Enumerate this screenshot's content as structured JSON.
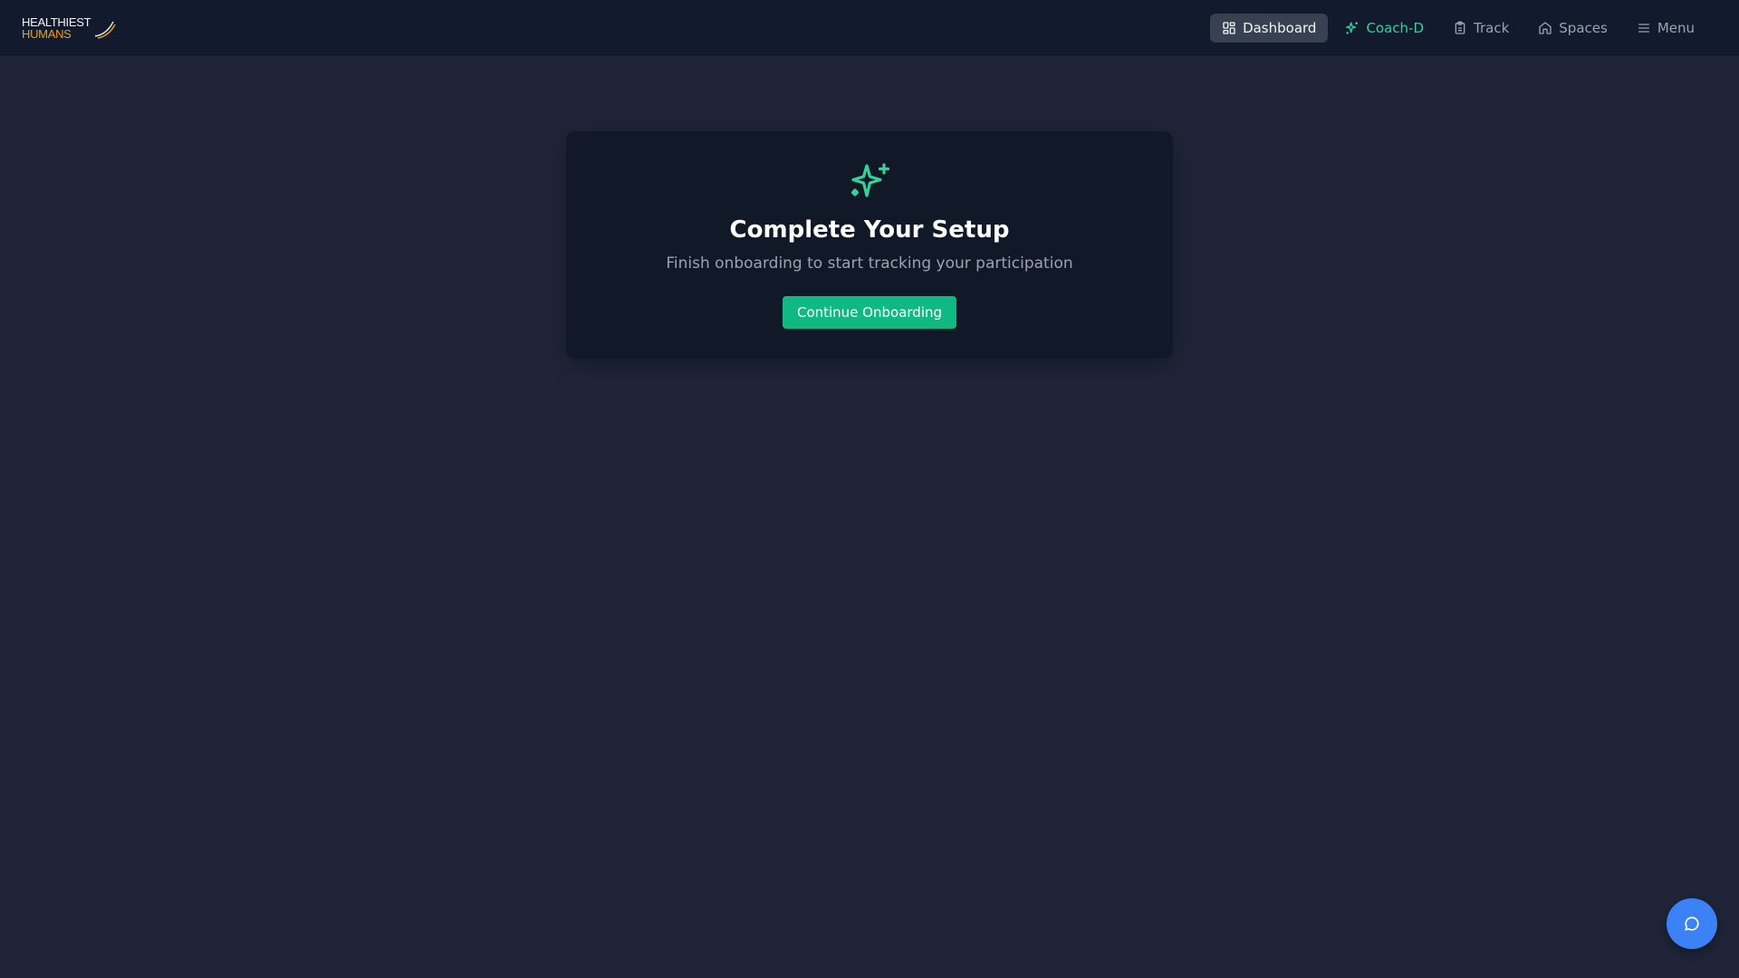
{
  "brand": {
    "line1": "HEALTHIEST",
    "line2": "HUMANS"
  },
  "nav": {
    "items": [
      {
        "label": "Dashboard",
        "icon": "dashboard-grid-icon",
        "active": true
      },
      {
        "label": "Coach-D",
        "icon": "sparkles-icon",
        "active": false
      },
      {
        "label": "Track",
        "icon": "clipboard-icon",
        "active": false
      },
      {
        "label": "Spaces",
        "icon": "home-icon",
        "active": false
      },
      {
        "label": "Menu",
        "icon": "hamburger-menu-icon",
        "active": false
      }
    ]
  },
  "setup_card": {
    "icon": "sparkles-icon",
    "title": "Complete Your Setup",
    "subtitle": "Finish onboarding to start tracking your participation",
    "button_label": "Continue Onboarding"
  },
  "chat_button": {
    "icon": "chat-bubble-icon"
  },
  "colors": {
    "background": "#1f2438",
    "topbar": "#121a2d",
    "card": "#111827",
    "accent_green": "#10b981",
    "accent_blue": "#3b82f6",
    "brand_orange": "#f59e0b"
  }
}
